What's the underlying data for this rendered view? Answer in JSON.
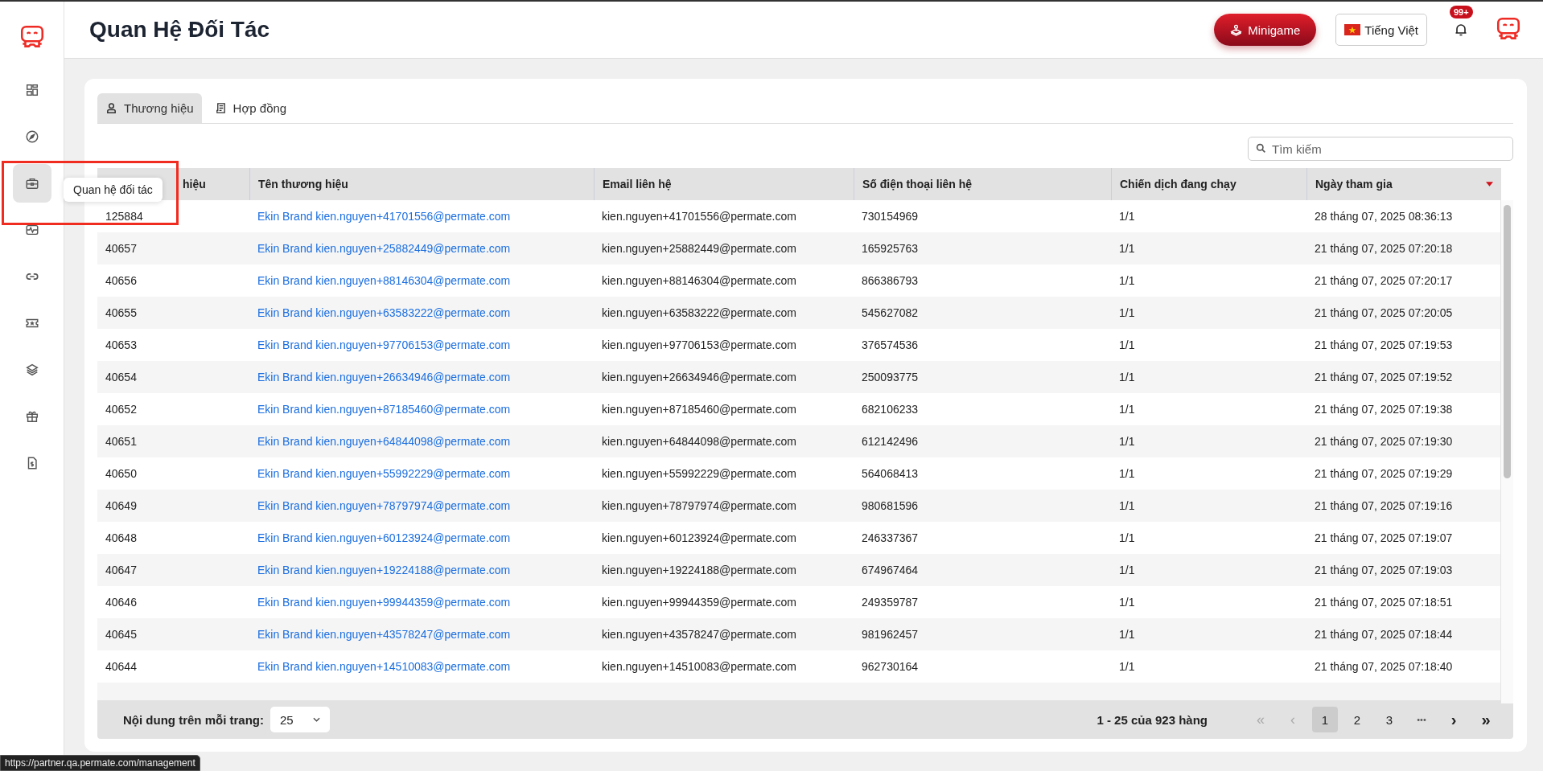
{
  "page_title": "Quan Hệ Đối Tác",
  "header": {
    "minigame_label": "Minigame",
    "language_label": "Tiếng Việt",
    "notification_badge": "99+"
  },
  "sidebar": {
    "items": [
      {
        "kind": "dashboard",
        "selected": false
      },
      {
        "kind": "compass",
        "selected": false
      },
      {
        "kind": "briefcase",
        "selected": true
      },
      {
        "kind": "pulse",
        "selected": false
      },
      {
        "kind": "link",
        "selected": false
      },
      {
        "kind": "ticket",
        "selected": false
      },
      {
        "kind": "layers",
        "selected": false
      },
      {
        "kind": "gift",
        "selected": false
      },
      {
        "kind": "invoice",
        "selected": false
      }
    ]
  },
  "tooltip": "Quan hệ đối tác",
  "tabs": [
    {
      "label": "Thương hiệu",
      "kind": "person",
      "selected": true
    },
    {
      "label": "Hợp đồng",
      "kind": "document",
      "selected": false
    }
  ],
  "search": {
    "placeholder": "Tìm kiếm"
  },
  "table": {
    "columns": [
      {
        "label": "hiệu",
        "sorted": false
      },
      {
        "label": "Tên thương hiệu",
        "sorted": false
      },
      {
        "label": "Email liên hệ",
        "sorted": false
      },
      {
        "label": "Số điện thoại liên hệ",
        "sorted": false
      },
      {
        "label": "Chiến dịch đang chạy",
        "sorted": false
      },
      {
        "label": "Ngày tham gia",
        "sorted": true
      }
    ],
    "rows": [
      [
        "125884",
        "Ekin Brand kien.nguyen+41701556@permate.com",
        "kien.nguyen+41701556@permate.com",
        "730154969",
        "1/1",
        "28 tháng 07, 2025 08:36:13"
      ],
      [
        "40657",
        "Ekin Brand kien.nguyen+25882449@permate.com",
        "kien.nguyen+25882449@permate.com",
        "165925763",
        "1/1",
        "21 tháng 07, 2025 07:20:18"
      ],
      [
        "40656",
        "Ekin Brand kien.nguyen+88146304@permate.com",
        "kien.nguyen+88146304@permate.com",
        "866386793",
        "1/1",
        "21 tháng 07, 2025 07:20:17"
      ],
      [
        "40655",
        "Ekin Brand kien.nguyen+63583222@permate.com",
        "kien.nguyen+63583222@permate.com",
        "545627082",
        "1/1",
        "21 tháng 07, 2025 07:20:05"
      ],
      [
        "40653",
        "Ekin Brand kien.nguyen+97706153@permate.com",
        "kien.nguyen+97706153@permate.com",
        "376574536",
        "1/1",
        "21 tháng 07, 2025 07:19:53"
      ],
      [
        "40654",
        "Ekin Brand kien.nguyen+26634946@permate.com",
        "kien.nguyen+26634946@permate.com",
        "250093775",
        "1/1",
        "21 tháng 07, 2025 07:19:52"
      ],
      [
        "40652",
        "Ekin Brand kien.nguyen+87185460@permate.com",
        "kien.nguyen+87185460@permate.com",
        "682106233",
        "1/1",
        "21 tháng 07, 2025 07:19:38"
      ],
      [
        "40651",
        "Ekin Brand kien.nguyen+64844098@permate.com",
        "kien.nguyen+64844098@permate.com",
        "612142496",
        "1/1",
        "21 tháng 07, 2025 07:19:30"
      ],
      [
        "40650",
        "Ekin Brand kien.nguyen+55992229@permate.com",
        "kien.nguyen+55992229@permate.com",
        "564068413",
        "1/1",
        "21 tháng 07, 2025 07:19:29"
      ],
      [
        "40649",
        "Ekin Brand kien.nguyen+78797974@permate.com",
        "kien.nguyen+78797974@permate.com",
        "980681596",
        "1/1",
        "21 tháng 07, 2025 07:19:16"
      ],
      [
        "40648",
        "Ekin Brand kien.nguyen+60123924@permate.com",
        "kien.nguyen+60123924@permate.com",
        "246337367",
        "1/1",
        "21 tháng 07, 2025 07:19:07"
      ],
      [
        "40647",
        "Ekin Brand kien.nguyen+19224188@permate.com",
        "kien.nguyen+19224188@permate.com",
        "674967464",
        "1/1",
        "21 tháng 07, 2025 07:19:03"
      ],
      [
        "40646",
        "Ekin Brand kien.nguyen+99944359@permate.com",
        "kien.nguyen+99944359@permate.com",
        "249359787",
        "1/1",
        "21 tháng 07, 2025 07:18:51"
      ],
      [
        "40645",
        "Ekin Brand kien.nguyen+43578247@permate.com",
        "kien.nguyen+43578247@permate.com",
        "981962457",
        "1/1",
        "21 tháng 07, 2025 07:18:44"
      ],
      [
        "40644",
        "Ekin Brand kien.nguyen+14510083@permate.com",
        "kien.nguyen+14510083@permate.com",
        "962730164",
        "1/1",
        "21 tháng 07, 2025 07:18:40"
      ]
    ]
  },
  "pagination": {
    "page_size_label": "Nội dung trên mỗi trang:",
    "page_size": "25",
    "range": "1 - 25 của 923 hàng",
    "first": "«",
    "prev": "‹",
    "pages": [
      {
        "label": "1",
        "selected": true
      },
      {
        "label": "2",
        "selected": false
      },
      {
        "label": "3",
        "selected": false
      }
    ],
    "ellipsis": "•••",
    "next": "›",
    "last": "»"
  },
  "status_url": "https://partner.qa.permate.com/management"
}
